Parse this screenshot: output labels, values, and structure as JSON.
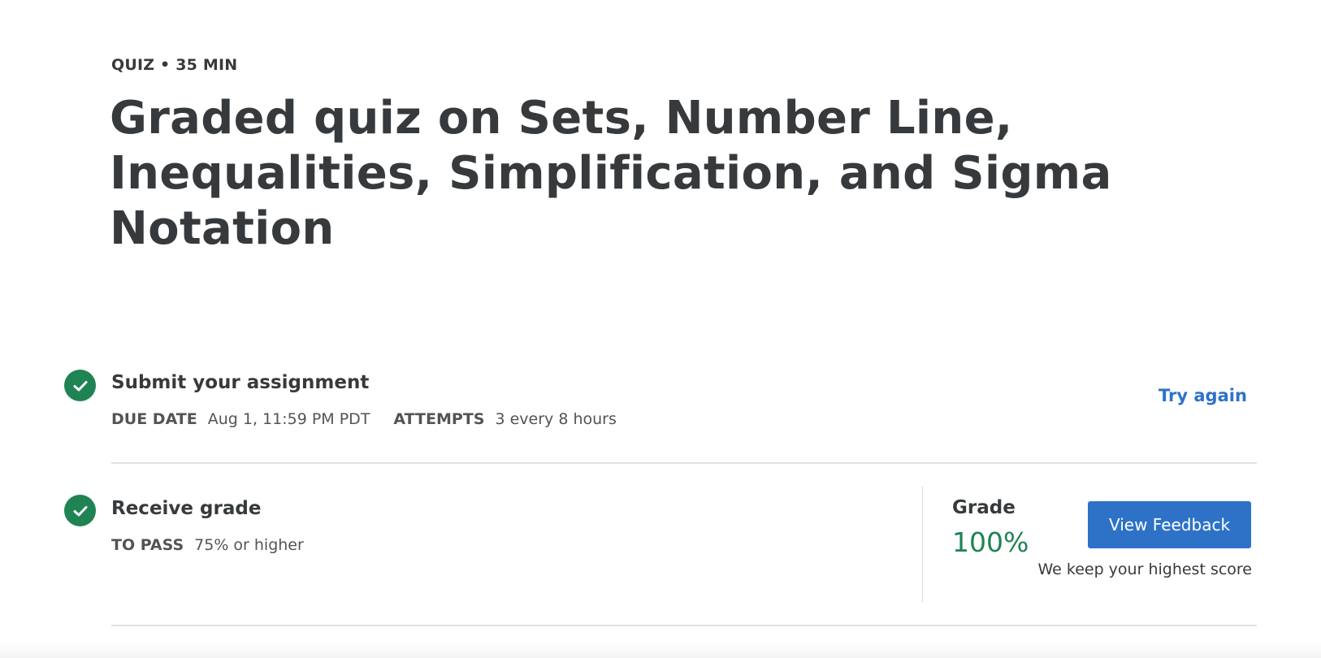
{
  "header": {
    "meta": "QUIZ • 35 MIN",
    "title": "Graded quiz on Sets, Number Line, Inequalities, Simplification, and Sigma Notation"
  },
  "submit": {
    "title": "Submit your assignment",
    "due_label": "DUE DATE",
    "due_value": "Aug 1, 11:59 PM PDT",
    "attempts_label": "ATTEMPTS",
    "attempts_value": "3 every 8 hours",
    "try_again": "Try again",
    "status_icon": "check-circle-icon"
  },
  "receive": {
    "title": "Receive grade",
    "pass_label": "TO PASS",
    "pass_value": "75% or higher",
    "grade_label": "Grade",
    "grade_value": "100%",
    "view_feedback": "View Feedback",
    "note": "We keep your highest score",
    "status_icon": "check-circle-icon"
  },
  "colors": {
    "success": "#1f8354",
    "primary": "#2d72c7",
    "text": "#373a3c",
    "divider": "#e1e1e1"
  }
}
